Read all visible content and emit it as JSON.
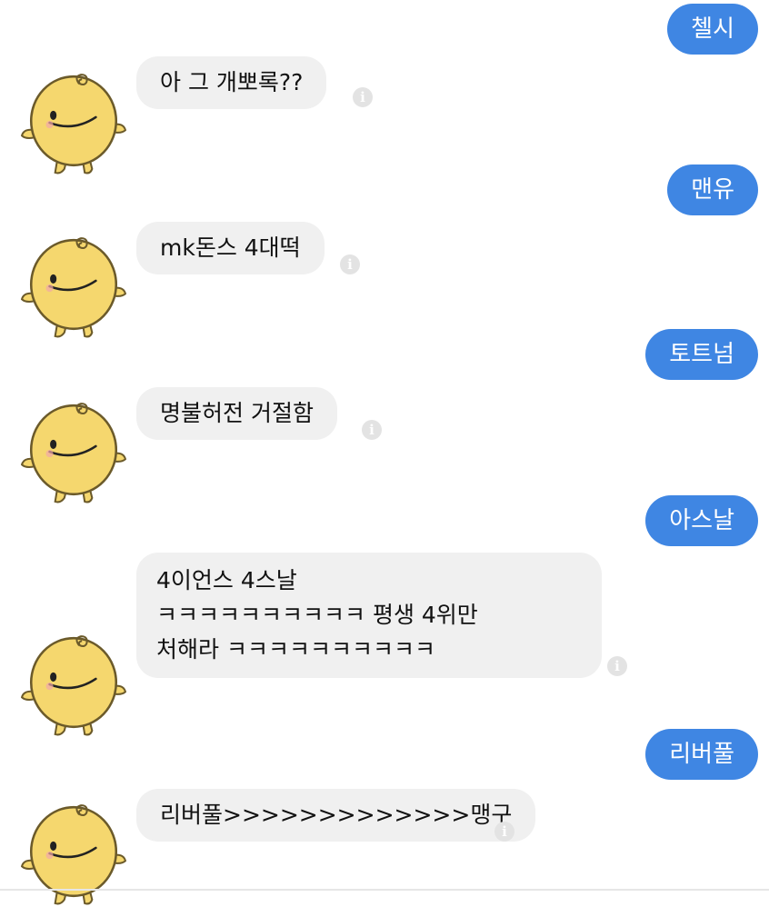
{
  "messages": [
    {
      "role": "user",
      "text": "첼시"
    },
    {
      "role": "bot",
      "text": "아 그 개뽀록??"
    },
    {
      "role": "user",
      "text": "맨유"
    },
    {
      "role": "bot",
      "text": "mk돈스 4대떡"
    },
    {
      "role": "user",
      "text": "토트넘"
    },
    {
      "role": "bot",
      "text": "명불허전 거절함"
    },
    {
      "role": "user",
      "text": "아스날"
    },
    {
      "role": "bot",
      "text": "4이언스 4스날\nㅋㅋㅋㅋㅋㅋㅋㅋㅋㅋ 평생 4위만\n처해라 ㅋㅋㅋㅋㅋㅋㅋㅋㅋㅋ"
    },
    {
      "role": "user",
      "text": "리버풀"
    },
    {
      "role": "bot",
      "text": "리버풀>>>>>>>>>>>>>맹구"
    }
  ],
  "colors": {
    "user_bubble": "#3f86e3",
    "bot_bubble": "#f0f0f0",
    "avatar": "#f5d76e"
  },
  "icons": {
    "avatar": "simsimi-character",
    "info": "info-icon"
  }
}
